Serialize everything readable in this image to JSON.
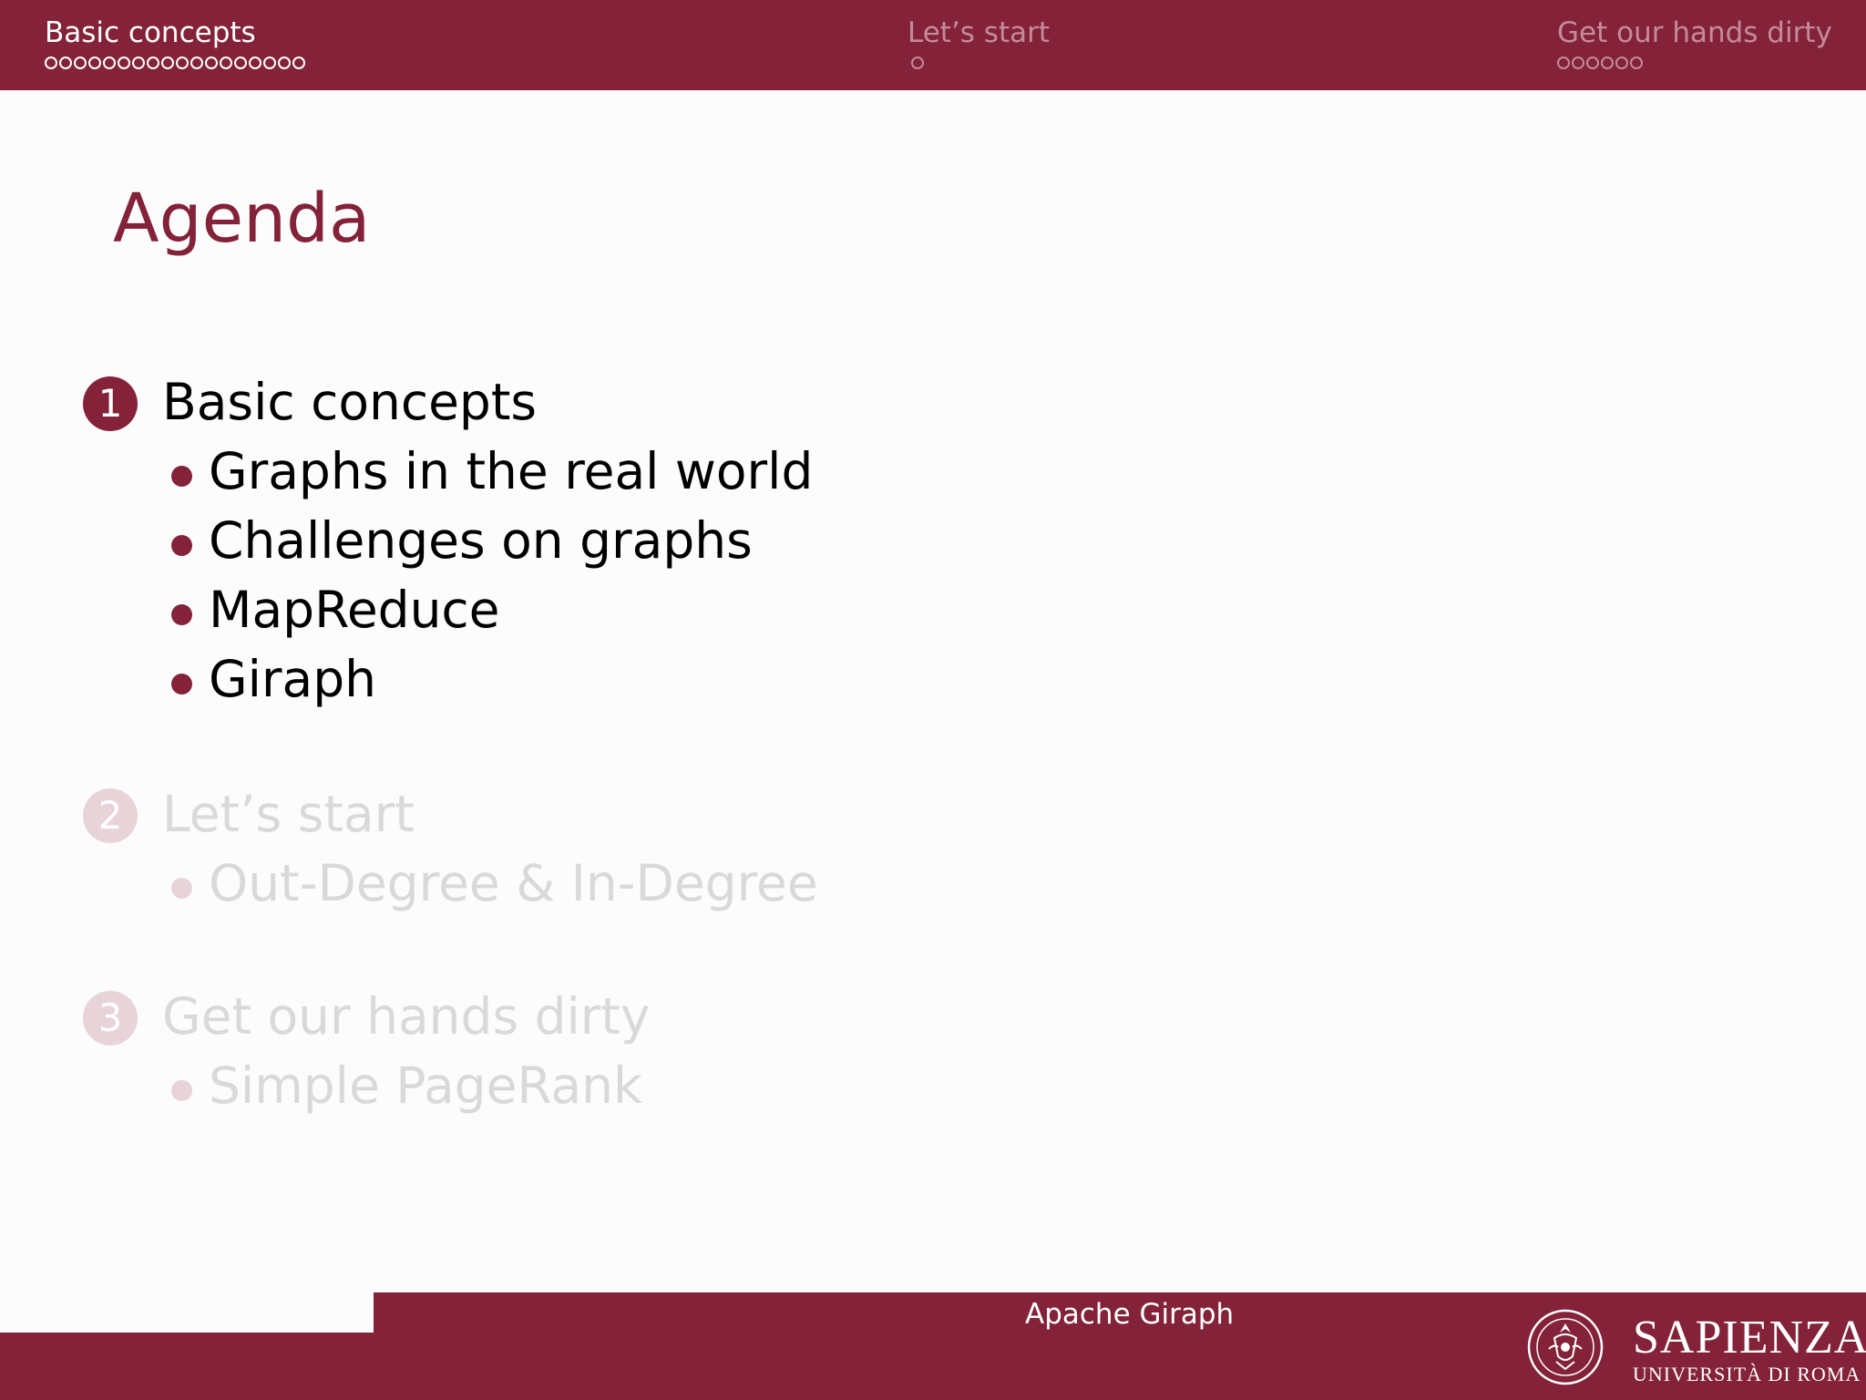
{
  "nav": {
    "sections": [
      {
        "label": "Basic concepts",
        "dots": 18,
        "active": true
      },
      {
        "label": "Let’s start",
        "dots": 1,
        "active": false
      },
      {
        "label": "Get our hands dirty",
        "dots": 6,
        "active": false
      }
    ]
  },
  "slide": {
    "title": "Agenda"
  },
  "agenda": [
    {
      "number": "1",
      "title": "Basic concepts",
      "items": [
        "Graphs in the real world",
        "Challenges on graphs",
        "MapReduce",
        "Giraph"
      ],
      "current": true
    },
    {
      "number": "2",
      "title": "Let’s start",
      "items": [
        "Out-Degree & In-Degree"
      ],
      "current": false
    },
    {
      "number": "3",
      "title": "Get our hands dirty",
      "items": [
        "Simple PageRank"
      ],
      "current": false
    }
  ],
  "footer": {
    "title": "Apache Giraph",
    "brand": "SAPIENZA",
    "brand_sub": "UNIVERSITÀ DI ROMA"
  },
  "colors": {
    "accent": "#832238",
    "inactive_nav": "#c48b98",
    "faded_text": "#d9d9d9",
    "faded_number": "#e8d3d8"
  }
}
